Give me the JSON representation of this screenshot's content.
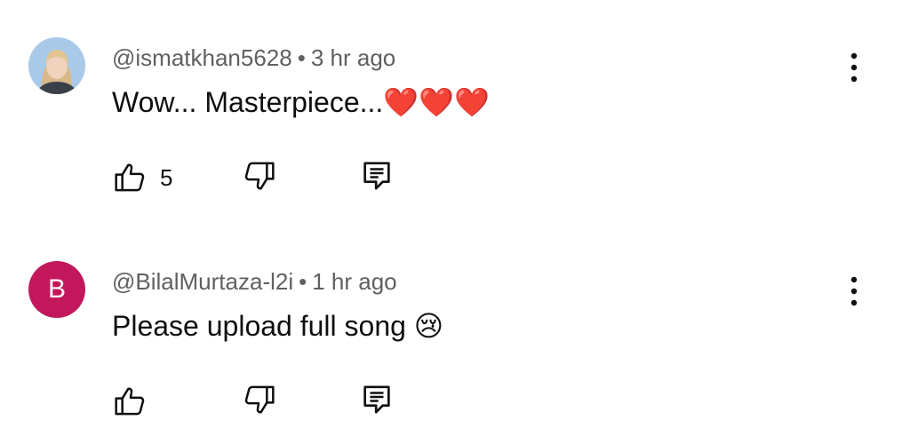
{
  "comments": [
    {
      "author": "@ismatkhan5628",
      "time": "3 hr ago",
      "text": "Wow... Masterpiece...❤️❤️❤️",
      "likes": "5",
      "avatar": {
        "type": "photo"
      }
    },
    {
      "author": "@BilalMurtaza-l2i",
      "time": "1 hr ago",
      "text": "Please upload full song 😢",
      "likes": "",
      "avatar": {
        "type": "letter",
        "letter": "B",
        "color": "#c2185b"
      }
    }
  ],
  "separator": "•",
  "icons": {
    "like": "thumbs-up-icon",
    "dislike": "thumbs-down-icon",
    "reply": "comment-reply-icon",
    "menu": "more-vertical-icon"
  }
}
